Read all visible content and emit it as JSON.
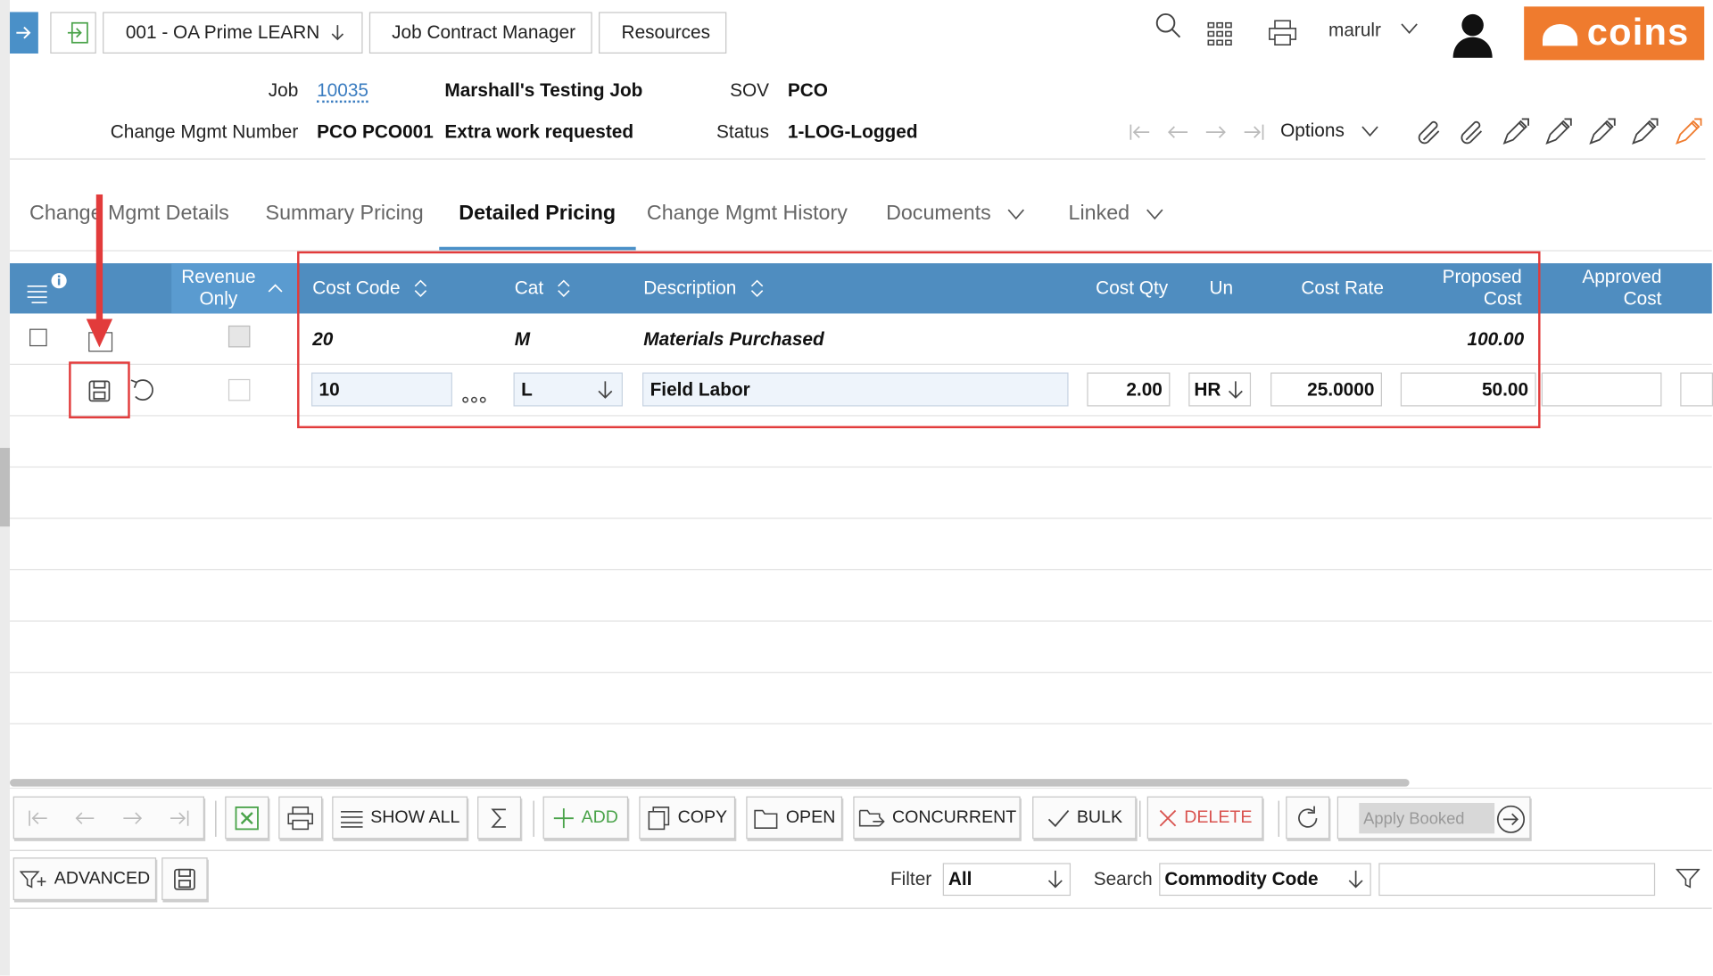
{
  "breadcrumb": {
    "company": "001 - OA Prime LEARN",
    "module": "Job Contract Manager",
    "section": "Resources"
  },
  "user": {
    "name": "marulr"
  },
  "brand": {
    "logo_text": "coins",
    "color": "#ef7b2e"
  },
  "record": {
    "job_label": "Job",
    "job_number": "10035",
    "job_name": "Marshall's Testing Job",
    "sov_label": "SOV",
    "sov_value": "PCO",
    "change_label": "Change Mgmt Number",
    "change_number": "PCO PCO001",
    "change_desc": "Extra work requested",
    "status_label": "Status",
    "status_value": "1-LOG-Logged",
    "options_label": "Options"
  },
  "tabs": [
    {
      "label": "Change Mgmt Details"
    },
    {
      "label": "Summary Pricing"
    },
    {
      "label": "Detailed Pricing"
    },
    {
      "label": "Change Mgmt History"
    },
    {
      "label": "Documents"
    },
    {
      "label": "Linked"
    }
  ],
  "grid": {
    "headers": {
      "revenue_only_1": "Revenue",
      "revenue_only_2": "Only",
      "cost_code": "Cost Code",
      "cat": "Cat",
      "description": "Description",
      "cost_qty": "Cost Qty",
      "un": "Un",
      "cost_rate": "Cost Rate",
      "proposed_cost_1": "Proposed",
      "proposed_cost_2": "Cost",
      "approved_cost_1": "Approved",
      "approved_cost_2": "Cost"
    },
    "rows": [
      {
        "cost_code": "20",
        "cat": "M",
        "description": "Materials Purchased",
        "proposed_cost": "100.00"
      },
      {
        "cost_code": "10",
        "cat": "L",
        "description": "Field Labor",
        "cost_qty": "2.00",
        "un": "HR",
        "cost_rate": "25.0000",
        "proposed_cost": "50.00"
      }
    ]
  },
  "toolbar": {
    "show_all": "SHOW ALL",
    "add": "ADD",
    "copy": "COPY",
    "open": "OPEN",
    "concurrent": "CONCURRENT",
    "bulk": "BULK",
    "delete": "DELETE",
    "apply_booked": "Apply Booked"
  },
  "filterbar": {
    "advanced": "ADVANCED",
    "filter_label": "Filter",
    "filter_value": "All",
    "search_label": "Search",
    "search_field": "Commodity Code",
    "search_text": ""
  },
  "colors": {
    "header_blue": "#4f8dc0",
    "highlight_red": "#e23b3b"
  }
}
